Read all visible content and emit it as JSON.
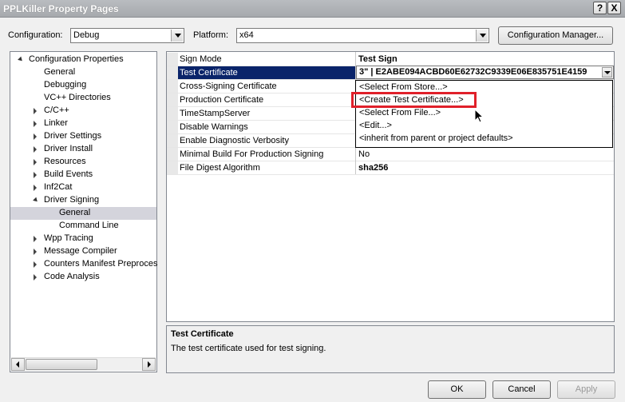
{
  "window": {
    "title": "PPLKiller Property Pages",
    "help_label": "?",
    "close_label": "X"
  },
  "toolbar": {
    "configuration_label": "Configuration:",
    "configuration_value": "Debug",
    "platform_label": "Platform:",
    "platform_value": "x64",
    "config_manager_label": "Configuration Manager..."
  },
  "tree": {
    "items": [
      {
        "label": "Configuration Properties",
        "expander": "open"
      },
      {
        "label": "General",
        "expander": "none"
      },
      {
        "label": "Debugging",
        "expander": "none"
      },
      {
        "label": "VC++ Directories",
        "expander": "none"
      },
      {
        "label": "C/C++",
        "expander": "closed"
      },
      {
        "label": "Linker",
        "expander": "closed"
      },
      {
        "label": "Driver Settings",
        "expander": "closed"
      },
      {
        "label": "Driver Install",
        "expander": "closed"
      },
      {
        "label": "Resources",
        "expander": "closed"
      },
      {
        "label": "Build Events",
        "expander": "closed"
      },
      {
        "label": "Inf2Cat",
        "expander": "closed"
      },
      {
        "label": "Driver Signing",
        "expander": "open"
      },
      {
        "label": "General",
        "expander": "none",
        "selected": true
      },
      {
        "label": "Command Line",
        "expander": "none"
      },
      {
        "label": "Wpp Tracing",
        "expander": "closed"
      },
      {
        "label": "Message Compiler",
        "expander": "closed"
      },
      {
        "label": "Counters Manifest Preproces",
        "expander": "closed"
      },
      {
        "label": "Code Analysis",
        "expander": "closed"
      }
    ]
  },
  "grid": {
    "rows": [
      {
        "name": "Sign Mode",
        "value": "Test Sign"
      },
      {
        "name": "Test Certificate",
        "value": "3\" | E2ABE094ACBD60E62732C9339E06E835751E4159"
      },
      {
        "name": "Cross-Signing Certificate",
        "value": ""
      },
      {
        "name": "Production Certificate",
        "value": ""
      },
      {
        "name": "TimeStampServer",
        "value": ""
      },
      {
        "name": "Disable Warnings",
        "value": ""
      },
      {
        "name": "Enable Diagnostic Verbosity",
        "value": ""
      },
      {
        "name": "Minimal Build For Production Signing",
        "value": "No"
      },
      {
        "name": "File Digest Algorithm",
        "value": "sha256"
      }
    ]
  },
  "dropdown": {
    "options": [
      "<Select From Store...>",
      "<Create Test Certificate...>",
      "<Select From File...>",
      "<Edit...>",
      "<inherit from parent or project defaults>"
    ],
    "highlight_color": "#e0202a"
  },
  "description": {
    "title": "Test Certificate",
    "text": "The test certificate used for test signing."
  },
  "buttons": {
    "ok": "OK",
    "cancel": "Cancel",
    "apply": "Apply"
  },
  "colors": {
    "selection": "#0a246a",
    "tree_selection": "#d4d4dc"
  }
}
